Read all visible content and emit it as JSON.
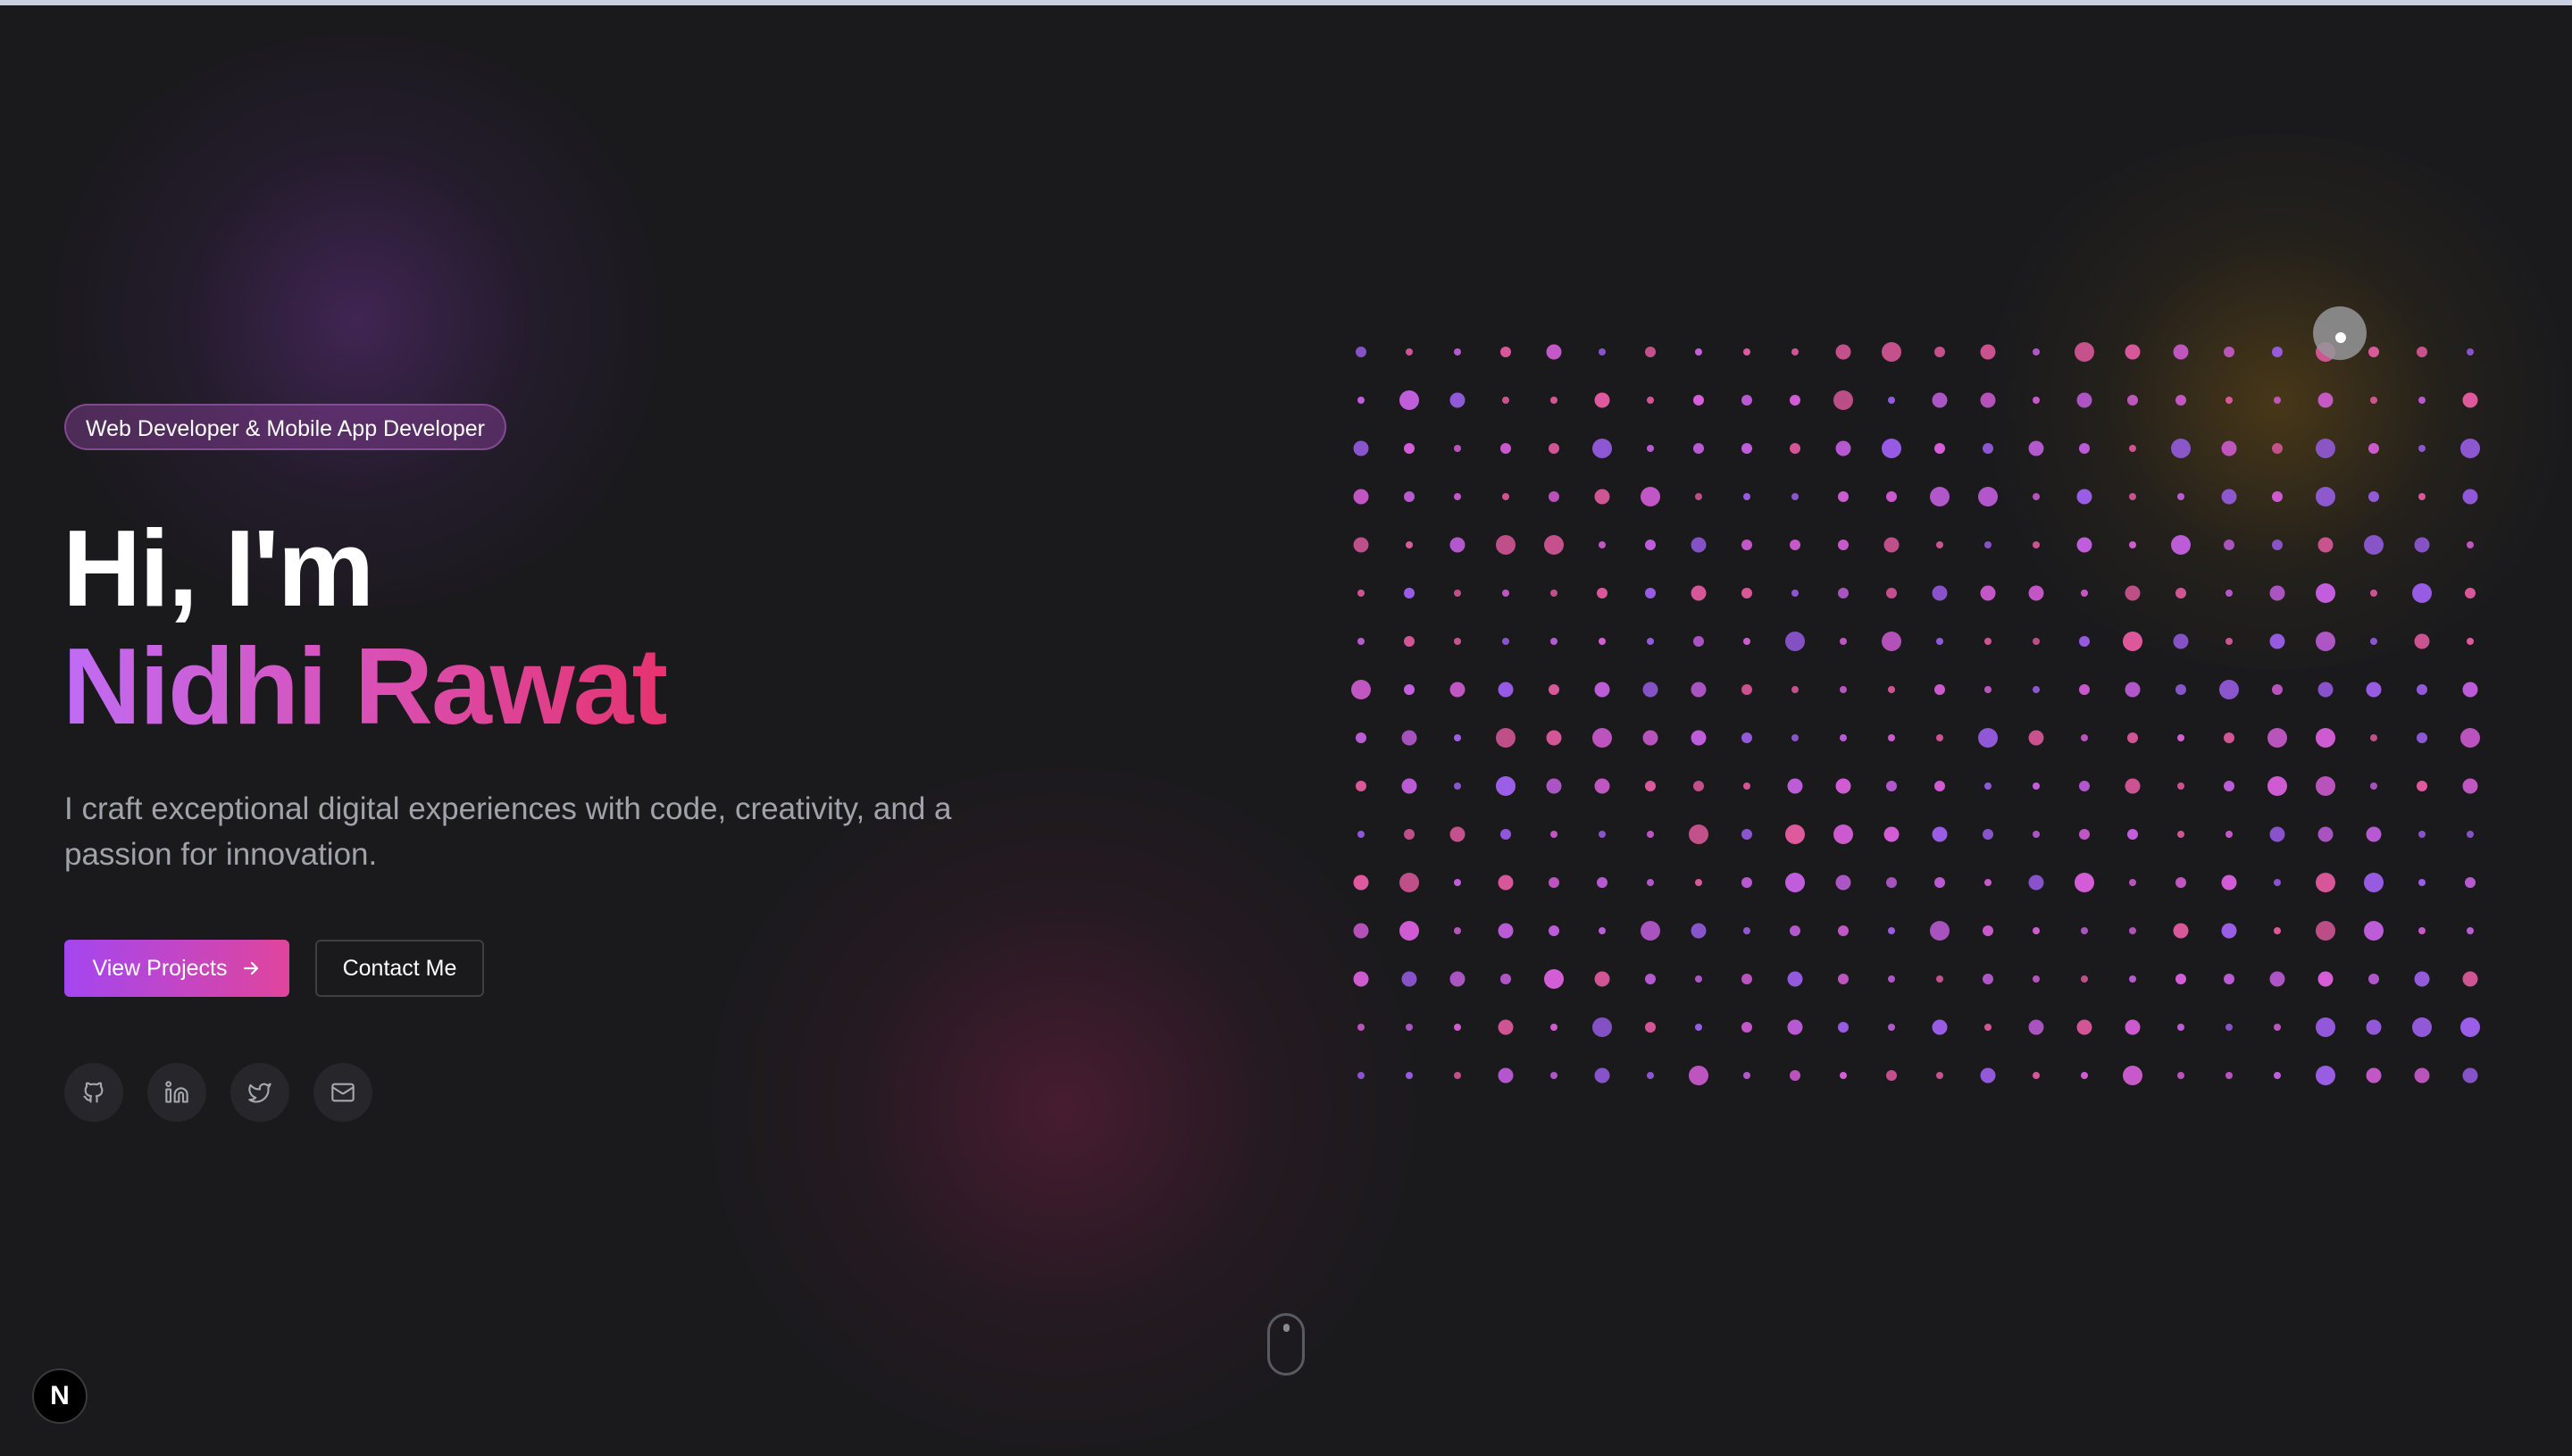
{
  "hero": {
    "badge": "Web Developer & Mobile App Developer",
    "greeting": "Hi, I'm",
    "name": "Nidhi Rawat",
    "tagline": "I craft exceptional digital experiences with code, creativity, and a passion for innovation."
  },
  "buttons": {
    "primary_label": "View Projects",
    "primary_icon": "arrow-right-icon",
    "secondary_label": "Contact Me"
  },
  "social": [
    {
      "icon": "github-icon"
    },
    {
      "icon": "linkedin-icon"
    },
    {
      "icon": "twitter-icon"
    },
    {
      "icon": "mail-icon"
    }
  ],
  "dot_grid": {
    "rows": 16,
    "columns": 24,
    "colors": [
      "#d65ed9",
      "#e05a9e",
      "#9b5ee8",
      "#c45fe0"
    ]
  },
  "framework_badge": "N",
  "colors": {
    "background": "#1a1a1d",
    "accent_purple": "#a346f0",
    "accent_pink": "#e0459c",
    "text_muted": "#a2a2ab"
  }
}
